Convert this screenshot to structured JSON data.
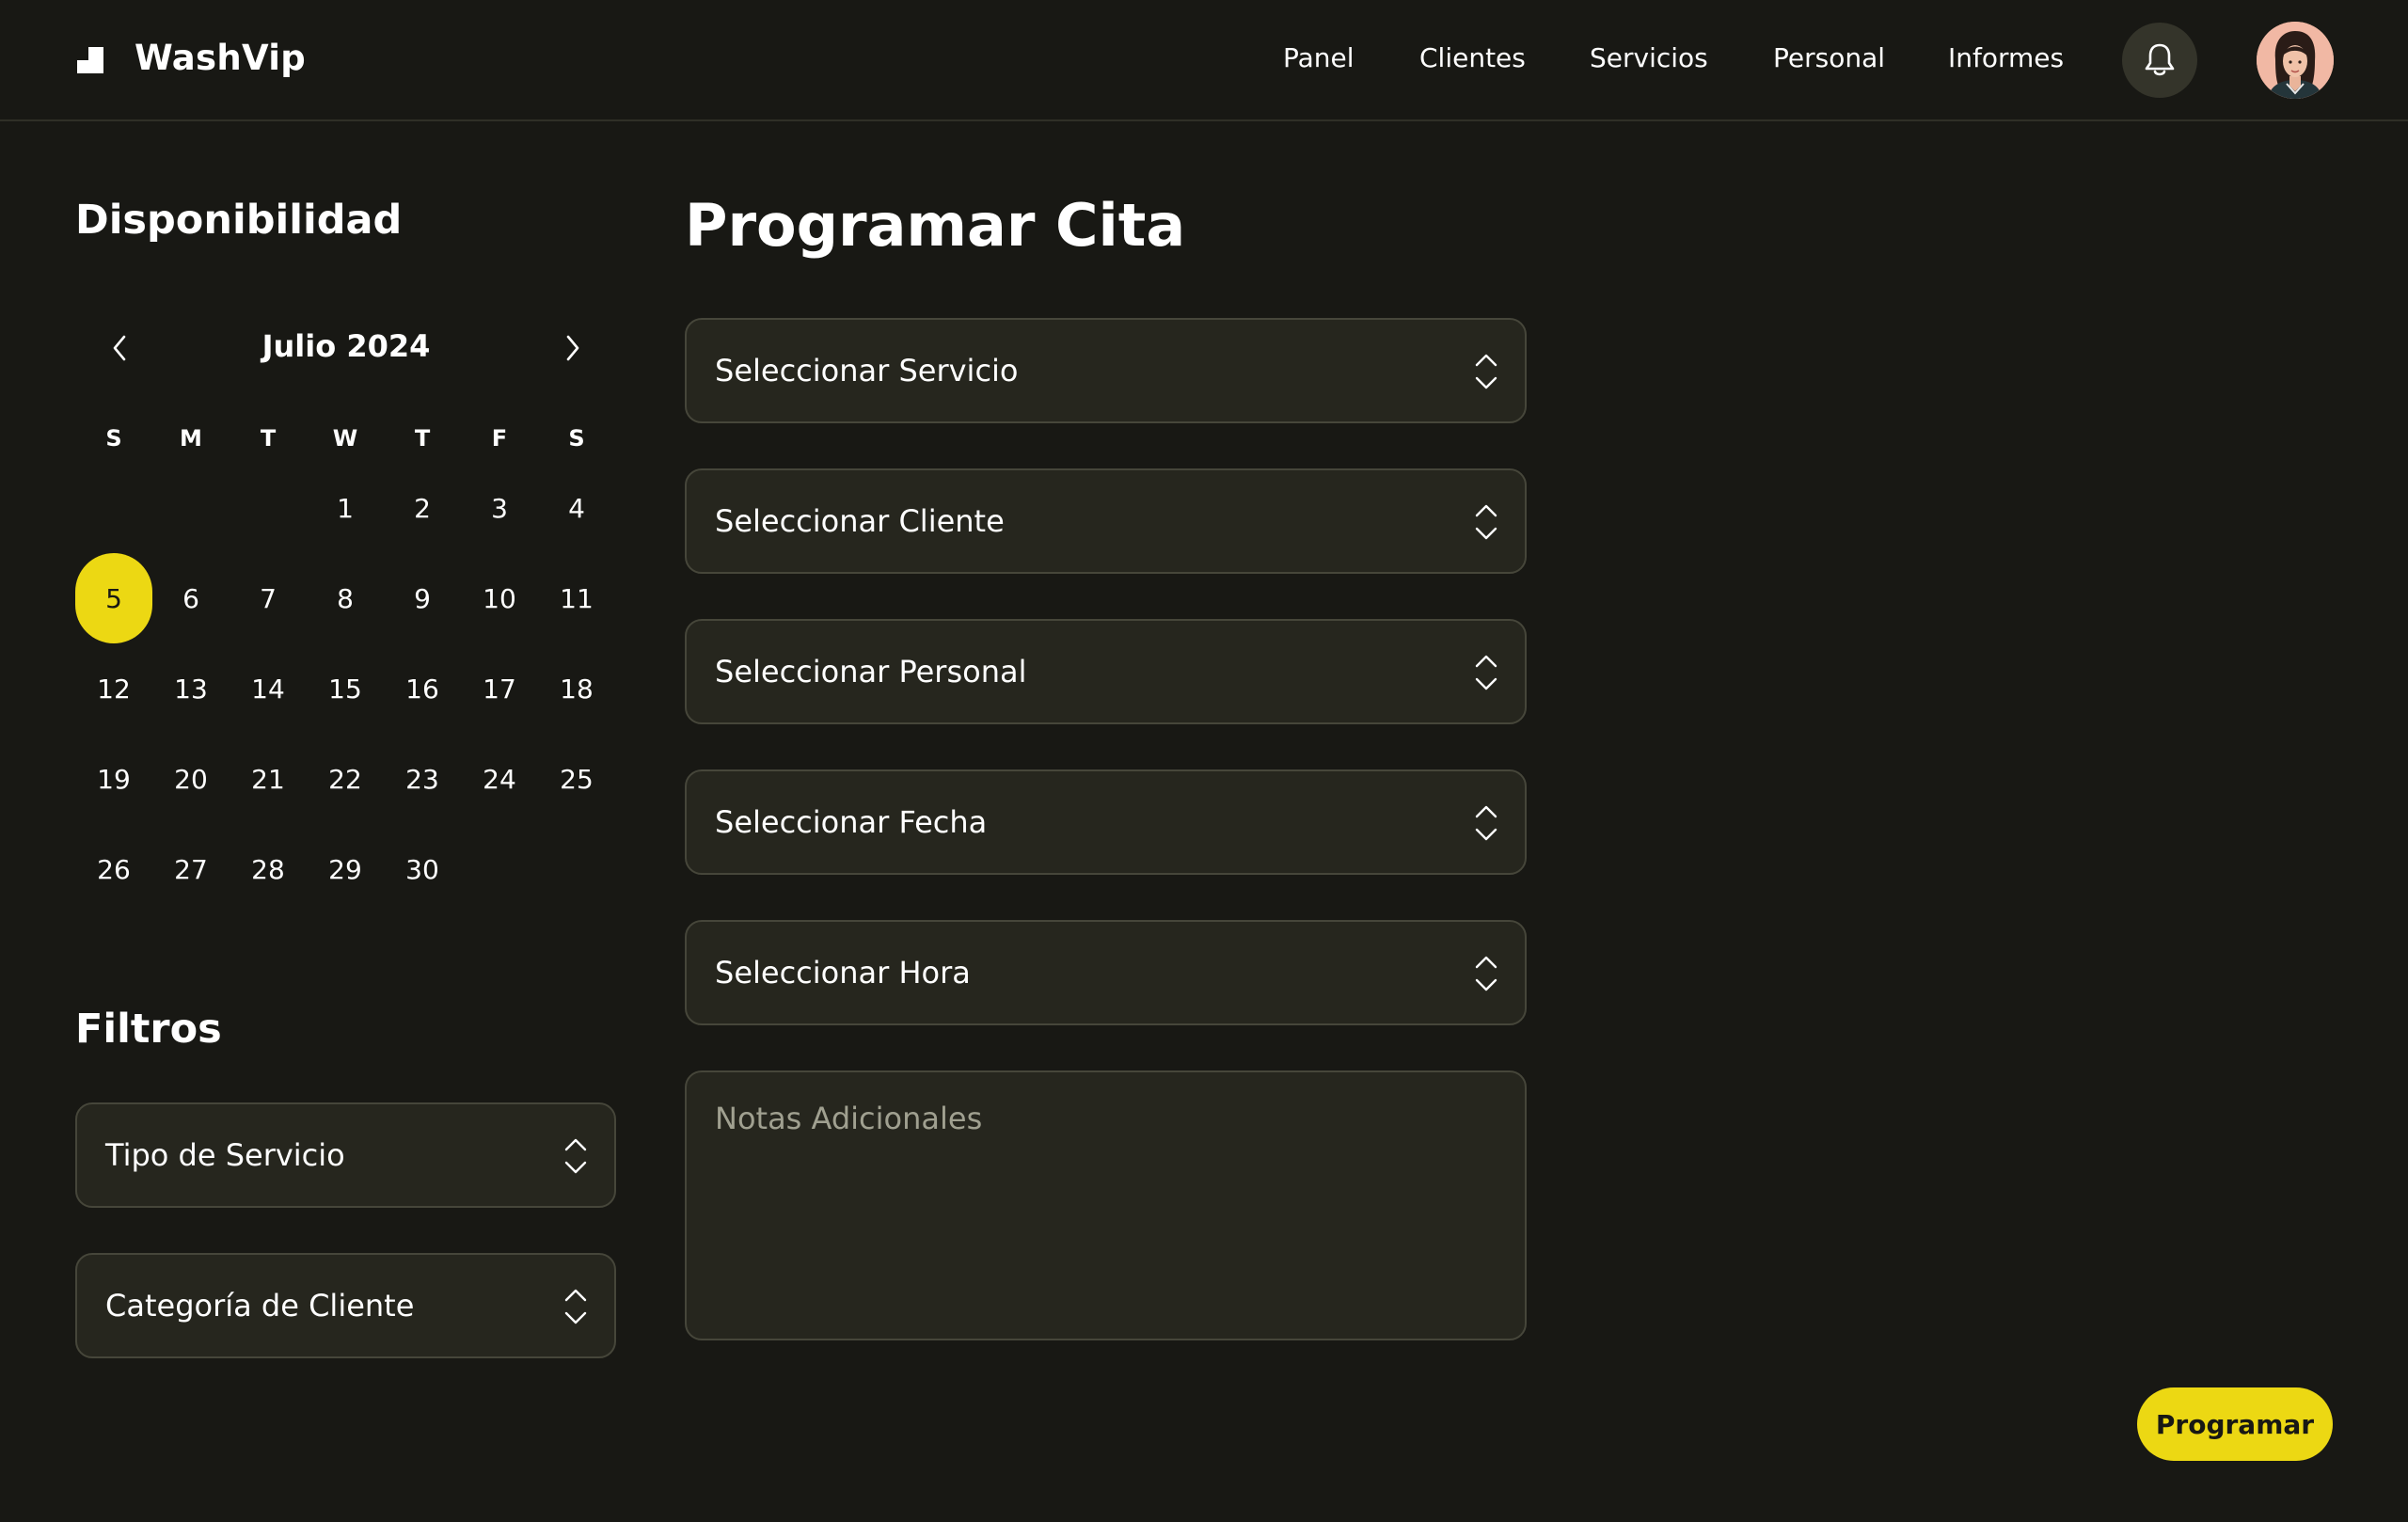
{
  "brand": {
    "name": "WashVip"
  },
  "nav": {
    "items": [
      {
        "label": "Panel"
      },
      {
        "label": "Clientes"
      },
      {
        "label": "Servicios"
      },
      {
        "label": "Personal"
      },
      {
        "label": "Informes"
      }
    ],
    "notifications_icon": "bell-icon",
    "avatar": "user-avatar"
  },
  "availability": {
    "title": "Disponibilidad",
    "month_label": "Julio 2024",
    "prev_icon": "chevron-left-icon",
    "next_icon": "chevron-right-icon",
    "weekdays": [
      "S",
      "M",
      "T",
      "W",
      "T",
      "F",
      "S"
    ],
    "weeks": [
      [
        "",
        "",
        "",
        "1",
        "2",
        "3",
        "4"
      ],
      [
        "5",
        "6",
        "7",
        "8",
        "9",
        "10",
        "11"
      ],
      [
        "12",
        "13",
        "14",
        "15",
        "16",
        "17",
        "18"
      ],
      [
        "19",
        "20",
        "21",
        "22",
        "23",
        "24",
        "25"
      ],
      [
        "26",
        "27",
        "28",
        "29",
        "30",
        "",
        ""
      ]
    ],
    "selected_day": "5"
  },
  "filters": {
    "title": "Filtros",
    "service_type": "Tipo de Servicio",
    "client_category": "Categoría de Cliente"
  },
  "form": {
    "title": "Programar Cita",
    "service": "Seleccionar Servicio",
    "client": "Seleccionar Cliente",
    "staff": "Seleccionar Personal",
    "date": "Seleccionar Fecha",
    "time": "Seleccionar Hora",
    "notes_placeholder": "Notas Adicionales",
    "notes_value": "",
    "submit_label": "Programar"
  },
  "colors": {
    "background": "#181814",
    "accent": "#ecd813",
    "field_bg": "#26261e",
    "field_border": "#46463a"
  }
}
